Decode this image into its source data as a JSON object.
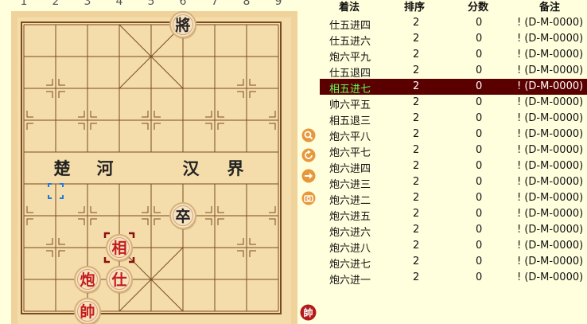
{
  "board": {
    "file_numbers": [
      "1",
      "2",
      "3",
      "4",
      "5",
      "6",
      "7",
      "8",
      "9"
    ],
    "river_left": [
      "楚",
      "河"
    ],
    "river_right": [
      "汉",
      "界"
    ],
    "pieces": [
      {
        "name": "black-general",
        "char": "將",
        "side": "black",
        "file": 6,
        "rank": 0,
        "selected": false
      },
      {
        "name": "black-soldier",
        "char": "卒",
        "side": "black",
        "file": 6,
        "rank": 6,
        "selected": false
      },
      {
        "name": "red-elephant",
        "char": "相",
        "side": "red",
        "file": 4,
        "rank": 7,
        "selected": true
      },
      {
        "name": "red-cannon",
        "char": "炮",
        "side": "red",
        "file": 3,
        "rank": 8,
        "selected": false
      },
      {
        "name": "red-advisor",
        "char": "仕",
        "side": "red",
        "file": 4,
        "rank": 8,
        "selected": false
      },
      {
        "name": "red-general",
        "char": "帥",
        "side": "red",
        "file": 3,
        "rank": 9,
        "selected": false
      }
    ],
    "last_move_from": {
      "file": 2,
      "rank": 5
    }
  },
  "side_icons": [
    {
      "name": "search-icon",
      "color": "#e08a2a"
    },
    {
      "name": "refresh-icon",
      "color": "#e08a2a"
    },
    {
      "name": "forward-icon",
      "color": "#e08a2a"
    },
    {
      "name": "camera-icon",
      "color": "#e08a2a"
    },
    {
      "name": "red-general-badge-icon",
      "char": "帥",
      "color": "#b41a1a"
    }
  ],
  "moves_table": {
    "headers": {
      "move": "着法",
      "order": "排序",
      "score": "分数",
      "note": "备注"
    },
    "selected_index": 4,
    "rows": [
      {
        "move": "仕五进四",
        "order": "2",
        "score": "0",
        "note": "! (D-M-0000)"
      },
      {
        "move": "仕五进六",
        "order": "2",
        "score": "0",
        "note": "! (D-M-0000)"
      },
      {
        "move": "炮六平九",
        "order": "2",
        "score": "0",
        "note": "! (D-M-0000)"
      },
      {
        "move": "仕五退四",
        "order": "2",
        "score": "0",
        "note": "! (D-M-0000)"
      },
      {
        "move": "相五进七",
        "order": "2",
        "score": "0",
        "note": "! (D-M-0000)"
      },
      {
        "move": "帅六平五",
        "order": "2",
        "score": "0",
        "note": "! (D-M-0000)"
      },
      {
        "move": "相五退三",
        "order": "2",
        "score": "0",
        "note": "! (D-M-0000)"
      },
      {
        "move": "炮六平八",
        "order": "2",
        "score": "0",
        "note": "! (D-M-0000)"
      },
      {
        "move": "炮六平七",
        "order": "2",
        "score": "0",
        "note": "! (D-M-0000)"
      },
      {
        "move": "炮六进四",
        "order": "2",
        "score": "0",
        "note": "! (D-M-0000)"
      },
      {
        "move": "炮六进三",
        "order": "2",
        "score": "0",
        "note": "! (D-M-0000)"
      },
      {
        "move": "炮六进二",
        "order": "2",
        "score": "0",
        "note": "! (D-M-0000)"
      },
      {
        "move": "炮六进五",
        "order": "2",
        "score": "0",
        "note": "! (D-M-0000)"
      },
      {
        "move": "炮六进六",
        "order": "2",
        "score": "0",
        "note": "! (D-M-0000)"
      },
      {
        "move": "炮六进八",
        "order": "2",
        "score": "0",
        "note": "! (D-M-0000)"
      },
      {
        "move": "炮六进七",
        "order": "2",
        "score": "0",
        "note": "! (D-M-0000)"
      },
      {
        "move": "炮六进一",
        "order": "2",
        "score": "0",
        "note": "! (D-M-0000)"
      }
    ]
  },
  "colors": {
    "board_bg": "#f3d9a6",
    "board_frame": "#eccf94",
    "grid": "#7a4b1f",
    "red_text": "#c21c1c",
    "black_text": "#222222",
    "piece_face": "#f6e2c0",
    "piece_ring": "#d8b07a",
    "selected_row_bg": "#5a0000",
    "selected_row_move": "#5cff5c"
  }
}
